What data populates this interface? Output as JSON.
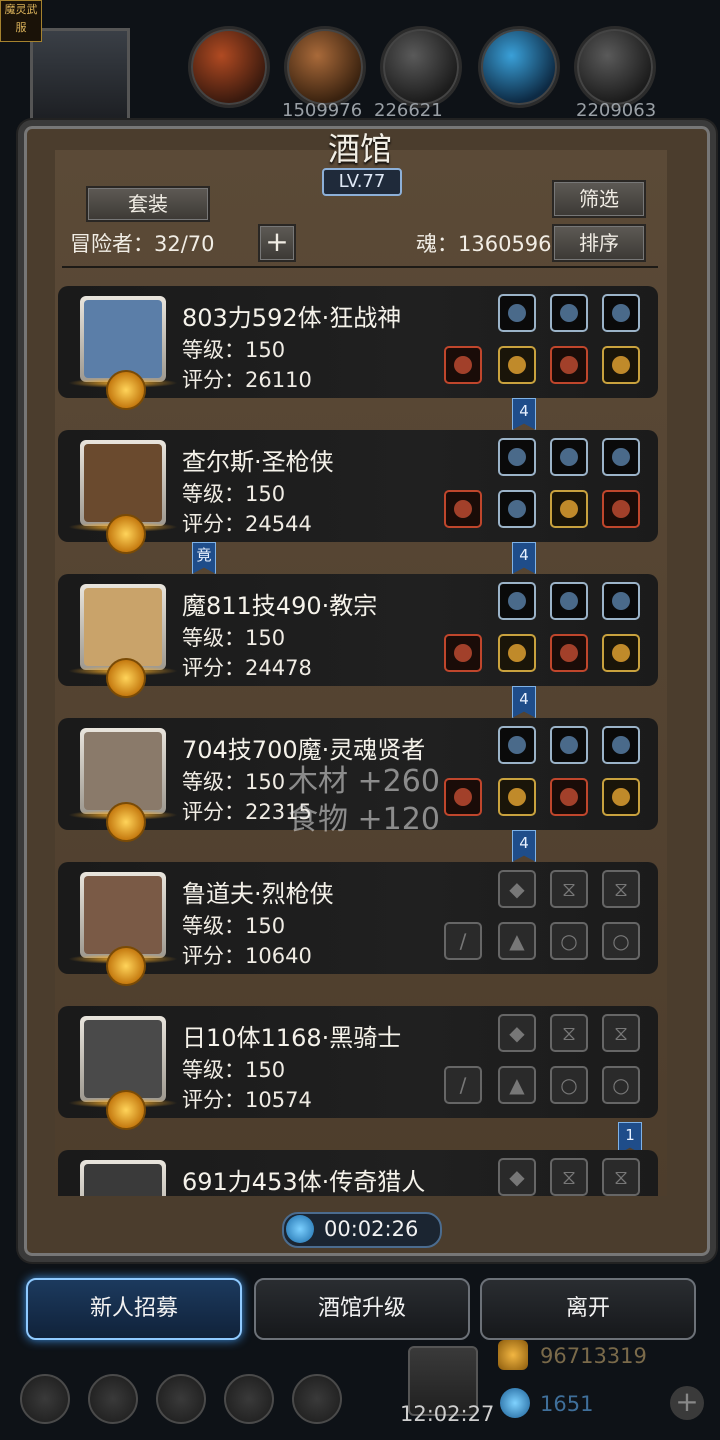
{
  "top_bar": {
    "avatar_label": "魔灵武服",
    "resources": [
      "1509976",
      "226621",
      "2209063"
    ]
  },
  "panel": {
    "title": "酒馆",
    "level": "LV.77",
    "set_button": "套装",
    "filter_button": "筛选",
    "sort_button": "排序",
    "adventurers": "冒险者：32/70",
    "add_button": "+",
    "soul": "魂：1360596"
  },
  "heroes": [
    {
      "name": "803力592体·狂战神",
      "level": "等级：150",
      "score": "评分：26110",
      "face": "#5b7ea8",
      "slots_top": [
        "blue",
        "blue",
        "blue"
      ],
      "slots_bottom": [
        "red",
        "gold",
        "red",
        "gold"
      ],
      "flag": "4"
    },
    {
      "name": "查尔斯·圣枪侠",
      "level": "等级：150",
      "score": "评分：24544",
      "face": "#6a4a2e",
      "slots_top": [
        "blue",
        "blue",
        "blue"
      ],
      "slots_bottom": [
        "red",
        "blue",
        "gold",
        "red"
      ],
      "flag": "4",
      "flag_left": "竟"
    },
    {
      "name": "魔811技490·教宗",
      "level": "等级：150",
      "score": "评分：24478",
      "face": "#c9a36a",
      "slots_top": [
        "blue",
        "blue",
        "blue"
      ],
      "slots_bottom": [
        "red",
        "gold",
        "red",
        "gold"
      ],
      "flag": "4"
    },
    {
      "name": "704技700魔·灵魂贤者",
      "level": "等级：150",
      "score": "评分：22315",
      "face": "#8a7a6a",
      "slots_top": [
        "blue",
        "blue",
        "blue"
      ],
      "slots_bottom": [
        "red",
        "gold",
        "red",
        "gold"
      ],
      "flag": "4"
    },
    {
      "name": "鲁道夫·烈枪侠",
      "level": "等级：150",
      "score": "评分：10640",
      "face": "#7a5a46",
      "slots_top": [
        "empty",
        "empty",
        "empty"
      ],
      "slots_bottom": [
        "empty",
        "empty",
        "empty",
        "empty"
      ]
    },
    {
      "name": "日10体1168·黑骑士",
      "level": "等级：150",
      "score": "评分：10574",
      "face": "#4a4a4a",
      "slots_top": [
        "empty",
        "empty",
        "empty"
      ],
      "slots_bottom": [
        "empty",
        "empty",
        "empty",
        "empty"
      ],
      "flag_right": "1"
    },
    {
      "name": "691力453体·传奇猎人",
      "level": "",
      "score": "",
      "face": "#3a3a3a",
      "slots_top": [
        "empty",
        "empty",
        "empty"
      ],
      "slots_bottom": []
    }
  ],
  "floating": {
    "wood": "木材 +260",
    "food": "食物 +120"
  },
  "timer": "00:02:26",
  "buttons": {
    "recruit": "新人招募",
    "upgrade": "酒馆升级",
    "leave": "离开"
  },
  "bottom": {
    "clock": "12:02:27",
    "gold": "96713319",
    "gems": "1651"
  }
}
